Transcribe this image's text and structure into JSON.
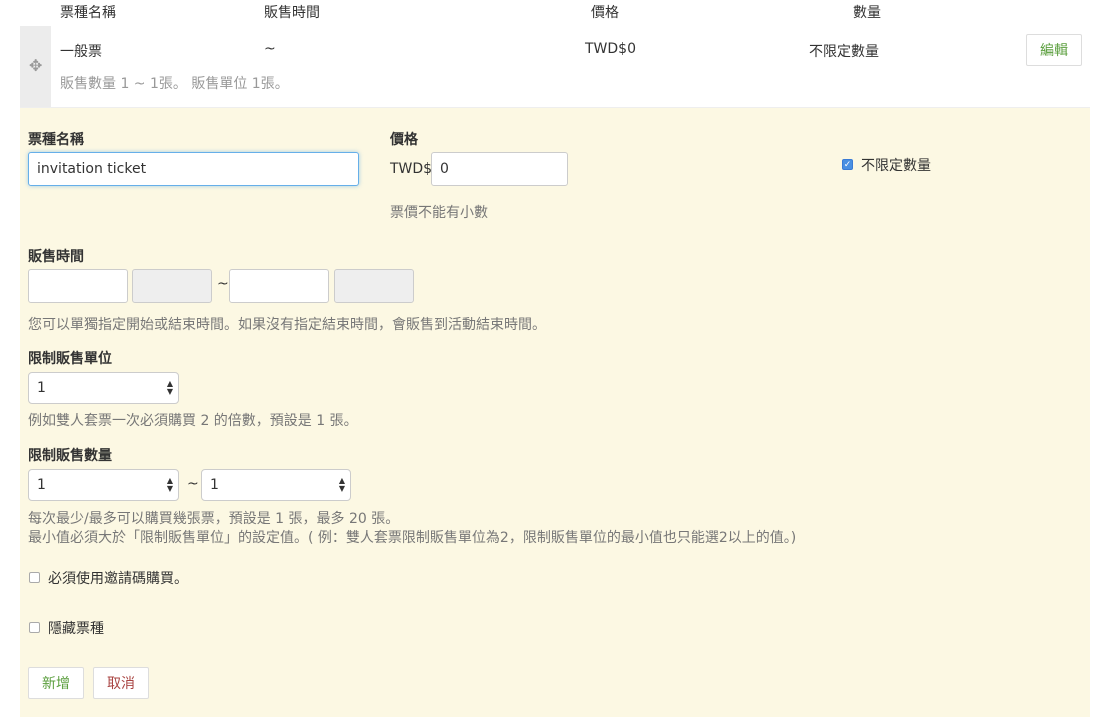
{
  "table": {
    "headers": [
      "票種名稱",
      "販售時間",
      "價格",
      "數量"
    ]
  },
  "ticket_row": {
    "name": "一般票",
    "sale_time": "~",
    "price": "TWD$0",
    "quantity": "不限定數量",
    "note": "販售數量 1 ~ 1張。 販售單位 1張。",
    "edit_label": "編輯"
  },
  "form": {
    "name_label": "票種名稱",
    "name_value": "invitation ticket",
    "price_label": "價格",
    "price_prefix": "TWD$",
    "price_value": "0",
    "price_help": "票價不能有小數",
    "unlimited_label": "不限定數量",
    "sale_time_label": "販售時間",
    "sale_time_sep": "~",
    "sale_time_help": "您可以單獨指定開始或結束時間。如果沒有指定結束時間，會販售到活動結束時間。",
    "unit_label": "限制販售單位",
    "unit_value": "1",
    "unit_help": "例如雙人套票一次必須購買 2 的倍數，預設是 1 張。",
    "qty_label": "限制販售數量",
    "qty_min": "1",
    "qty_sep": "~",
    "qty_max": "1",
    "qty_help_1": "每次最少/最多可以購買幾張票，預設是 1 張，最多 20 張。",
    "qty_help_2": "最小值必須大於「限制販售單位」的設定值。( 例：雙人套票限制販售單位為2，限制販售單位的最小值也只能選2以上的值。)",
    "invite_label": "必須使用邀請碼購買。",
    "hide_label": "隱藏票種",
    "add_label": "新增",
    "cancel_label": "取消"
  },
  "colors": {
    "panel_bg": "#fcf8e3",
    "add_text": "#5a9e3d",
    "cancel_text": "#a94442",
    "edit_text": "#5a9e3d"
  },
  "icons": {
    "drag": "drag-handle-icon",
    "checkmark": "checkmark-icon",
    "select_arrows": "select-arrows-icon"
  }
}
